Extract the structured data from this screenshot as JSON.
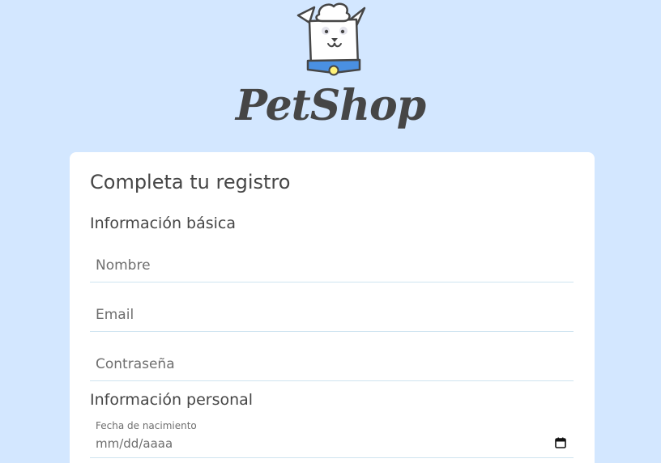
{
  "brand": {
    "name": "PetShop"
  },
  "form": {
    "title": "Completa tu registro",
    "basic_section": "Información básica",
    "personal_section": "Información personal",
    "name_placeholder": "Nombre",
    "email_placeholder": "Email",
    "password_placeholder": "Contraseña",
    "birthdate_label": "Fecha de nacimiento",
    "birthdate_placeholder": "mm/dd/aaaa"
  },
  "icons": {
    "logo": "dog-mascot-icon",
    "date_picker": "calendar-icon"
  },
  "colors": {
    "background": "#d3e7ff",
    "card": "#ffffff",
    "text": "#464646",
    "collar": "#4a90e2",
    "tag": "#fff27a"
  }
}
